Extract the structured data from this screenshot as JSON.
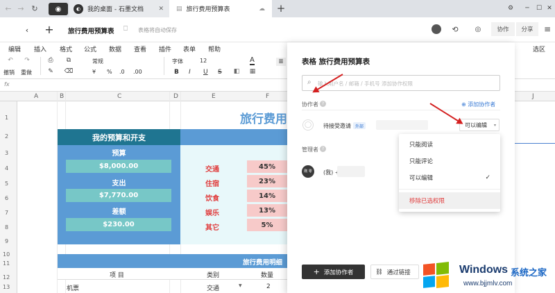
{
  "browser": {
    "tab1": "我的桌面 - 石墨文档",
    "tab2": "旅行费用预算表"
  },
  "header": {
    "doc_title": "旅行费用预算表",
    "autosave": "表格将自动保存",
    "collab": "协作",
    "share": "分享"
  },
  "menus": [
    "编辑",
    "插入",
    "格式",
    "公式",
    "数据",
    "查看",
    "插件",
    "表单",
    "帮助"
  ],
  "menus_right": "选区",
  "toolbar": {
    "undo": "撤销",
    "redo": "重做",
    "format": "常规",
    "font": "字体",
    "size": "12",
    "currency": "¥",
    "percent": "%",
    "dec0": ".0",
    "dec00": ".00",
    "bold": "B",
    "italic": "I",
    "underline": "U",
    "strike": "S",
    "color": "A"
  },
  "fx": "fx",
  "columns": [
    "A",
    "B",
    "C",
    "D",
    "E",
    "F",
    "J"
  ],
  "rows": [
    "1",
    "2",
    "3",
    "4",
    "5",
    "6",
    "7",
    "8",
    "9",
    "10",
    "11",
    "12",
    "13"
  ],
  "sheet": {
    "big_title": "旅行费用",
    "box_title": "我的预算和开支",
    "budget_label": "预算",
    "budget_value": "$8,000.00",
    "spent_label": "支出",
    "spent_value": "$7,770.00",
    "diff_label": "差额",
    "diff_value": "$230.00",
    "cats": [
      {
        "name": "交通",
        "pct": "45%"
      },
      {
        "name": "住宿",
        "pct": "23%"
      },
      {
        "name": "饮食",
        "pct": "14%"
      },
      {
        "name": "娱乐",
        "pct": "13%"
      },
      {
        "name": "其它",
        "pct": "5%"
      }
    ],
    "detail_title": "旅行费用明细",
    "detail_headers": [
      "项 目",
      "类别",
      "数量"
    ],
    "row13": [
      "机票",
      "交通",
      "2"
    ]
  },
  "panel": {
    "title": "表格 旅行费用预算表",
    "search_placeholder": "输入用户名 / 邮箱 / 手机号 添加协作权限",
    "collaborators_label": "协作者",
    "add_collab_link": "添加协作者",
    "pending": "待接受邀请",
    "external_badge": "外部",
    "can_edit": "可以编辑",
    "admins_label": "管理者",
    "me": "(我) +",
    "avatar_text": "刚 零",
    "add_button": "添加协作者",
    "link_button": "通过链接"
  },
  "dropdown": {
    "items": [
      "只能阅读",
      "只能评论",
      "可以编辑"
    ],
    "remove": "移除已选权限",
    "selected_index": 2
  },
  "watermark": {
    "title": "Windows",
    "title2": "系统之家",
    "url": "www.bjjmlv.com"
  },
  "colors": {
    "teal": "#1f7591",
    "box_blue": "#5b9bd5",
    "bar_teal": "#77c7c7",
    "pink": "#f7cac9",
    "light_cyan": "#e8f8fa",
    "red_text": "#e03c3c"
  }
}
